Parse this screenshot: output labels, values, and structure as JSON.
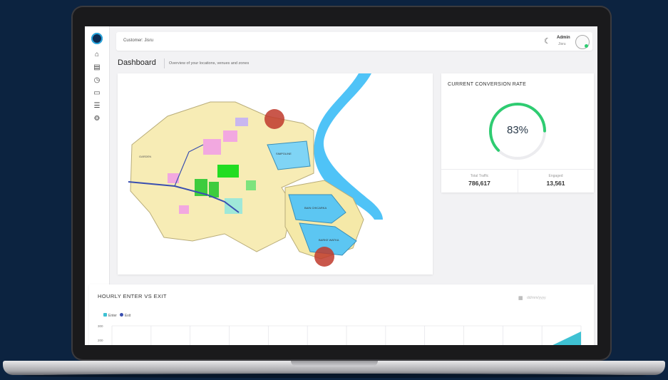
{
  "topbar": {
    "customer": "Customer: Jisru",
    "user_name": "Admin",
    "user_role": "Jisru"
  },
  "header": {
    "title": "Dashboard",
    "subtitle": "Overview of your locations, venues and zones"
  },
  "map": {
    "labels": [
      "GARDEN",
      "SIMPOLINE",
      "BAIN CHICARKA",
      "BARKE WATKA"
    ]
  },
  "conversion": {
    "title": "CURRENT CONVERSION RATE",
    "value": "83%",
    "percent": 83,
    "accent": "#2ecc71",
    "stats": [
      {
        "label": "Total Traffic",
        "value": "786,617"
      },
      {
        "label": "Engaged",
        "value": "13,561"
      }
    ]
  },
  "hourly": {
    "title": "HOURLY ENTER VS EXIT",
    "date_placeholder": "dd/mm/yyyy",
    "calendar_icon": "calendar-icon"
  },
  "chart_data": {
    "type": "area",
    "title": "HOURLY ENTER VS EXIT",
    "series": [
      {
        "name": "Enter",
        "color": "#3ec1d3"
      },
      {
        "name": "Exit",
        "color": "#3a4fb0"
      }
    ],
    "y_ticks": [
      "300",
      "200"
    ],
    "grid": true,
    "legend": "top-left"
  },
  "colors": {
    "brand": "#0d2c54",
    "accent": "#2aa8e0",
    "gauge": "#2ecc71",
    "water": "#4fc3f7",
    "hotspot": "#c0392b"
  },
  "nav_icons": [
    "home-icon",
    "layout-icon",
    "clock-icon",
    "monitor-icon",
    "server-icon",
    "gear-icon"
  ]
}
